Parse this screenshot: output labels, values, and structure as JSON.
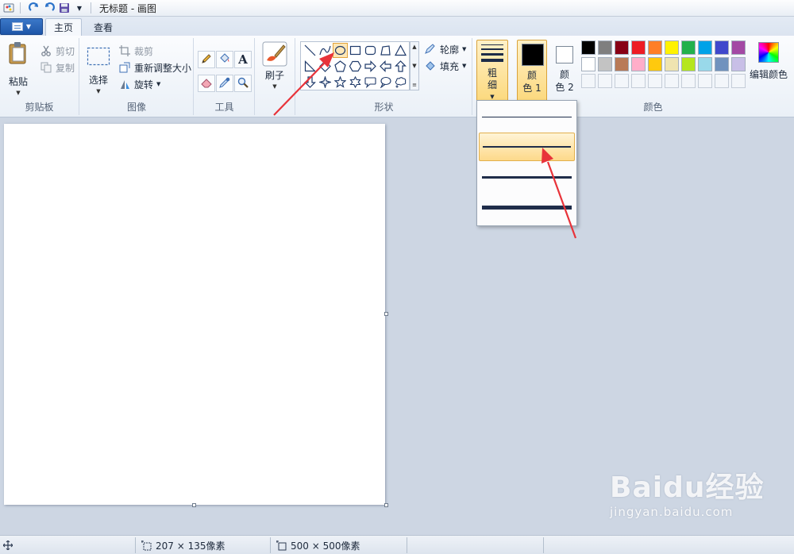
{
  "titlebar": {
    "title": "无标题 - 画图",
    "quick_access": [
      "paint-app-icon",
      "redo-icon",
      "undo-icon",
      "save-icon",
      "customize-caret-icon"
    ]
  },
  "tabs": {
    "home": "主页",
    "view": "查看"
  },
  "ribbon": {
    "clipboard": {
      "label": "剪贴板",
      "paste": "粘贴",
      "cut": "剪切",
      "copy": "复制"
    },
    "image": {
      "label": "图像",
      "select": "选择",
      "crop": "裁剪",
      "resize": "重新调整大小",
      "rotate": "旋转"
    },
    "tools": {
      "label": "工具",
      "text_tool_glyph": "A"
    },
    "brushes": {
      "label": "刷子"
    },
    "shapes": {
      "label": "形状",
      "outline": "轮廓",
      "fill": "填充",
      "selected_shape": "oval"
    },
    "size": {
      "label_line1": "粗",
      "label_line2": "细"
    },
    "colors": {
      "label": "颜色",
      "color1_line1": "颜",
      "color1_line2": "色 1",
      "color2_line1": "颜",
      "color2_line2": "色 2",
      "color1_value": "#000000",
      "color2_value": "#ffffff",
      "edit": "编辑颜色",
      "palette_row1": [
        "#000000",
        "#7f7f7f",
        "#880015",
        "#ed1c24",
        "#ff7f27",
        "#fff200",
        "#22b14c",
        "#00a2e8",
        "#3f48cc",
        "#a349a4"
      ],
      "palette_row2": [
        "#ffffff",
        "#c3c3c3",
        "#b97a57",
        "#ffaec9",
        "#ffc90e",
        "#efe4b0",
        "#b5e61d",
        "#99d9ea",
        "#7092be",
        "#c8bfe7"
      ]
    }
  },
  "size_dropdown": {
    "options": [
      "1px",
      "3px",
      "5px",
      "8px"
    ],
    "hovered_index": 1
  },
  "statusbar": {
    "selection_size": "207 × 135像素",
    "canvas_size": "500 × 500像素"
  },
  "watermark": {
    "logo": "Baidu经验",
    "url": "jingyan.baidu.com"
  },
  "accent": {
    "highlight": "#fcd97e",
    "annotation_arrow": "#e8333a"
  }
}
